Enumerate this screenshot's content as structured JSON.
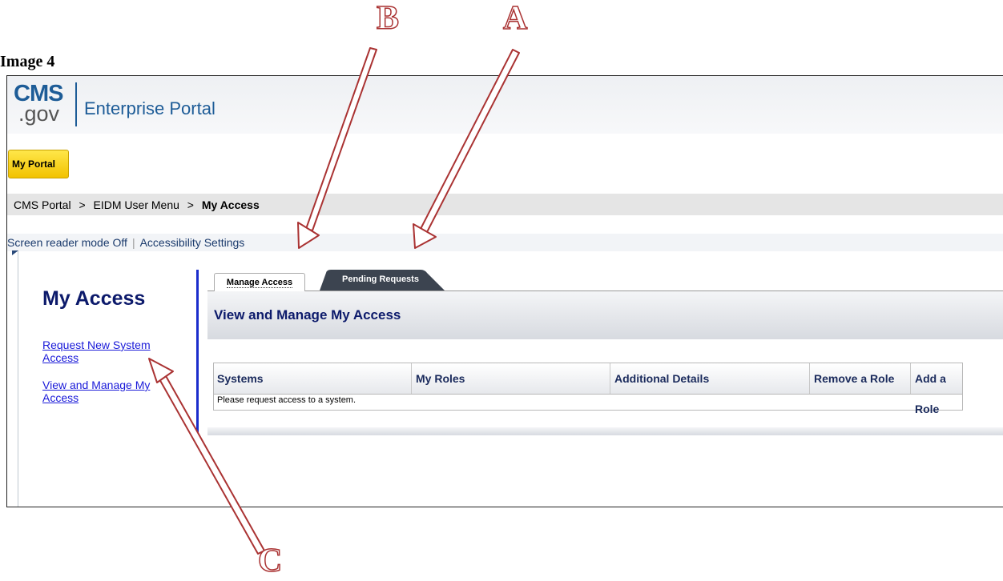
{
  "doc_title": "Image 4",
  "annotations": {
    "a": "A",
    "b": "B",
    "c": "C"
  },
  "portal": {
    "logo_cms": "CMS",
    "logo_gov": ".gov",
    "logo_text": "Enterprise Portal",
    "my_portal_button": "My Portal"
  },
  "breadcrumb": {
    "items": [
      "CMS Portal",
      "EIDM User Menu",
      "My Access"
    ],
    "separator": ">"
  },
  "accessibility": {
    "screen_reader": "Screen reader mode Off",
    "settings": "Accessibility Settings"
  },
  "sidebar": {
    "title": "My Access",
    "links": [
      "Request New System Access",
      "View and Manage My Access"
    ]
  },
  "tabs": [
    {
      "label": "Manage Access",
      "active": true
    },
    {
      "label": "Pending Requests",
      "active": false
    }
  ],
  "main": {
    "heading": "View and Manage My Access",
    "table": {
      "columns": [
        "Systems",
        "My Roles",
        "Additional Details",
        "Remove a Role",
        "Add a Role"
      ],
      "empty_message": "Please request access to a system."
    }
  },
  "colors": {
    "brand_blue": "#1d5c97",
    "heading_navy": "#0c1a6b",
    "link_blue": "#1a1ad9",
    "portal_yellow": "#f2c200",
    "annotation_red": "#a33"
  }
}
